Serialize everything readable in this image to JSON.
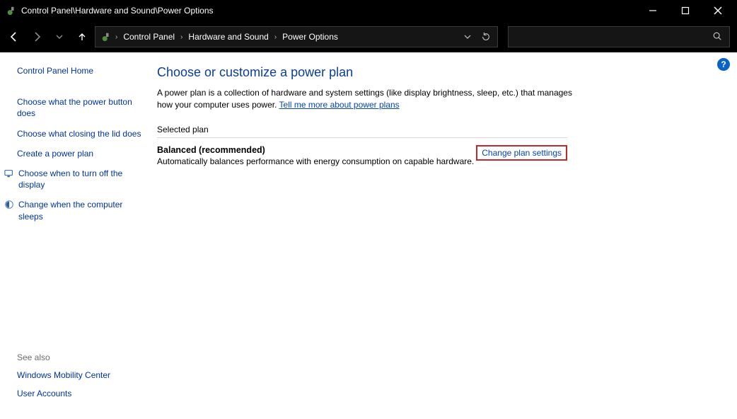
{
  "titlebar": {
    "title": "Control Panel\\Hardware and Sound\\Power Options"
  },
  "breadcrumb": {
    "items": [
      "Control Panel",
      "Hardware and Sound",
      "Power Options"
    ]
  },
  "sidebar": {
    "home": "Control Panel Home",
    "links": [
      "Choose what the power button does",
      "Choose what closing the lid does",
      "Create a power plan",
      "Choose when to turn off the display",
      "Change when the computer sleeps"
    ],
    "see_also_label": "See also",
    "see_also": [
      "Windows Mobility Center",
      "User Accounts"
    ]
  },
  "main": {
    "heading": "Choose or customize a power plan",
    "desc_1": "A power plan is a collection of hardware and system settings (like display brightness, sleep, etc.) that manages how your computer uses power. ",
    "desc_link": "Tell me more about power plans",
    "section_label": "Selected plan",
    "plan_name": "Balanced (recommended)",
    "plan_sub": "Automatically balances performance with energy consumption on capable hardware.",
    "change_link": "Change plan settings"
  },
  "help": "?"
}
